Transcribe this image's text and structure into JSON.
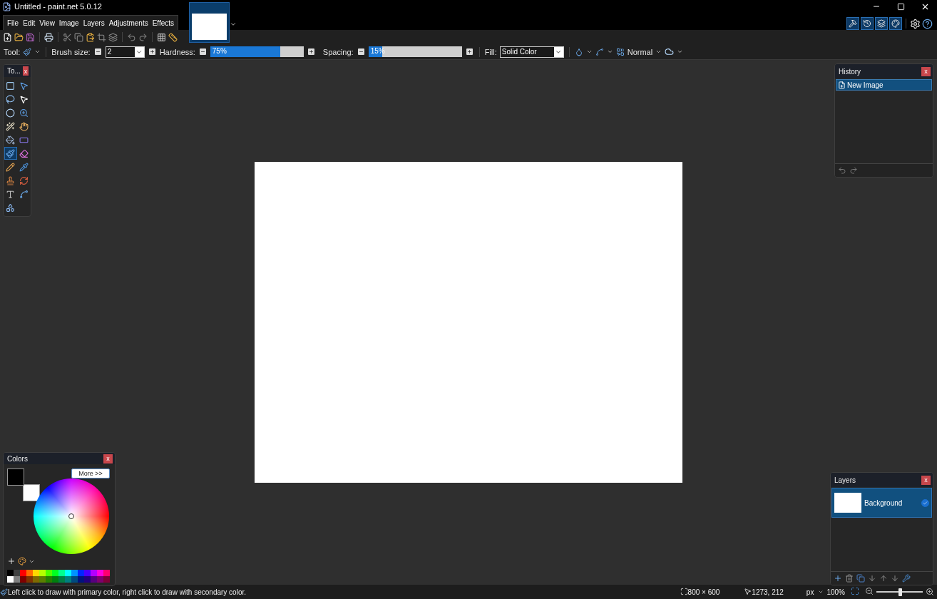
{
  "window": {
    "title": "Untitled - paint.net 5.0.12"
  },
  "menu": [
    "File",
    "Edit",
    "View",
    "Image",
    "Layers",
    "Adjustments",
    "Effects"
  ],
  "image_tabs": [
    {
      "selected": true
    }
  ],
  "panel_toggles": [
    {
      "kind": "tools",
      "on": true
    },
    {
      "kind": "history",
      "on": true
    },
    {
      "kind": "layers",
      "on": true
    },
    {
      "kind": "colors",
      "on": true
    }
  ],
  "tool_options": {
    "tool_label": "Tool:",
    "brush_size": {
      "label": "Brush size:",
      "value": "2"
    },
    "hardness": {
      "label": "Hardness:",
      "value": "75%",
      "level": 0.75
    },
    "spacing": {
      "label": "Spacing:",
      "value": "15%",
      "level": 0.15
    },
    "fill": {
      "label": "Fill:",
      "value": "Solid Color"
    },
    "blend_mode": "Normal"
  },
  "tools_panel": {
    "title": "To...",
    "close": "x",
    "tools": [
      {
        "kind": "rectselect",
        "selected": false
      },
      {
        "kind": "move",
        "selected": false
      },
      {
        "kind": "lasso",
        "selected": false
      },
      {
        "kind": "movesel",
        "selected": false
      },
      {
        "kind": "ellipse",
        "selected": false
      },
      {
        "kind": "zoom",
        "selected": false
      },
      {
        "kind": "wand",
        "selected": false
      },
      {
        "kind": "pan",
        "selected": false
      },
      {
        "kind": "bucket",
        "selected": false
      },
      {
        "kind": "gradient",
        "selected": false
      },
      {
        "kind": "brush",
        "selected": true
      },
      {
        "kind": "eraser",
        "selected": false
      },
      {
        "kind": "pencil",
        "selected": false
      },
      {
        "kind": "picker",
        "selected": false
      },
      {
        "kind": "stamp",
        "selected": false
      },
      {
        "kind": "recolor",
        "selected": false
      },
      {
        "kind": "text",
        "selected": false
      },
      {
        "kind": "line",
        "selected": false
      },
      {
        "kind": "shapes",
        "selected": false
      }
    ]
  },
  "history_panel": {
    "title": "History",
    "close": "x",
    "items": [
      {
        "label": "New Image",
        "selected": true
      }
    ]
  },
  "colors_panel": {
    "title": "Colors",
    "close": "x",
    "more_button": "More >>"
  },
  "layers_panel": {
    "title": "Layers",
    "close": "x",
    "items": [
      {
        "name": "Background",
        "selected": true,
        "visible": true
      }
    ]
  },
  "status_bar": {
    "hint": "Left click to draw with primary color, right click to draw with secondary color.",
    "image_size": "800 × 600",
    "cursor": "1273, 212",
    "units": "px",
    "zoom": "100%",
    "zoom_level": {
      "level": 0.5
    }
  }
}
